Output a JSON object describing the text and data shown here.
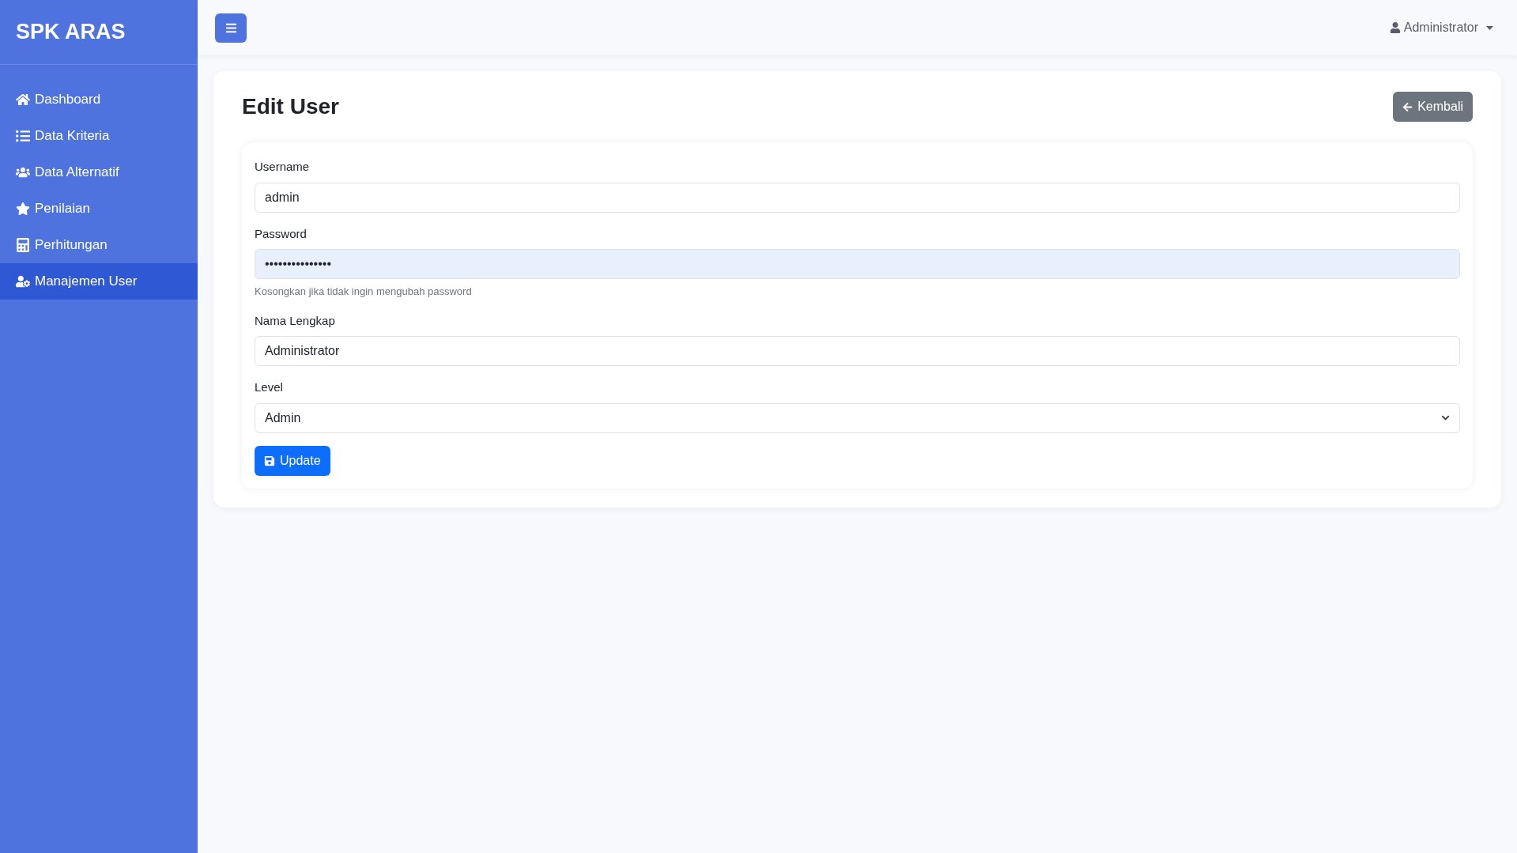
{
  "sidebar": {
    "brand": "SPK ARAS",
    "items": [
      {
        "label": "Dashboard",
        "selected": false
      },
      {
        "label": "Data Kriteria",
        "selected": false
      },
      {
        "label": "Data Alternatif",
        "selected": false
      },
      {
        "label": "Penilaian",
        "selected": false
      },
      {
        "label": "Perhitungan",
        "selected": false
      },
      {
        "label": "Manajemen User",
        "selected": true
      }
    ]
  },
  "topbar": {
    "user": "Administrator"
  },
  "page": {
    "title": "Edit User",
    "back_button": "Kembali"
  },
  "form": {
    "fields": [
      {
        "kind": "text",
        "label": "Username",
        "value": "admin"
      },
      {
        "kind": "password",
        "label": "Password",
        "value": "•••••••••••••••",
        "autofilled": true,
        "help": "Kosongkan jika tidak ingin mengubah password"
      },
      {
        "kind": "text",
        "label": "Nama Lengkap",
        "value": "Administrator"
      },
      {
        "kind": "select",
        "label": "Level",
        "value": "Admin"
      }
    ],
    "submit": "Update"
  }
}
